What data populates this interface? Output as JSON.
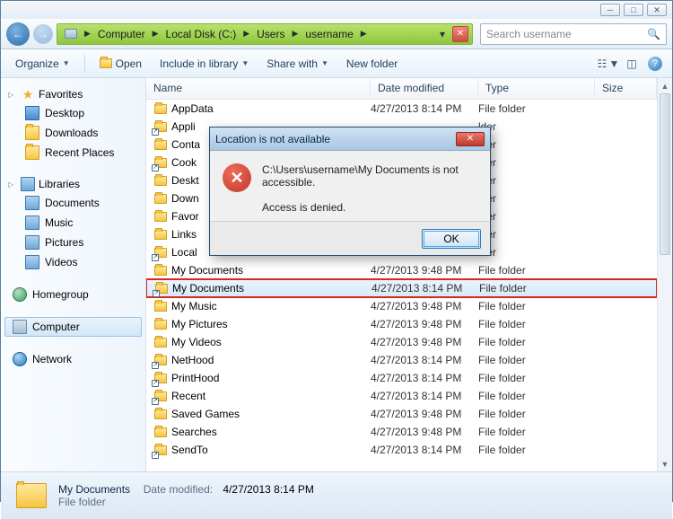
{
  "window": {
    "min": "─",
    "max": "□",
    "close": "✕"
  },
  "nav": {
    "back_icon": "←",
    "fwd_icon": "→"
  },
  "breadcrumb": [
    {
      "label": "Computer"
    },
    {
      "label": "Local Disk (C:)"
    },
    {
      "label": "Users"
    },
    {
      "label": "username"
    }
  ],
  "search": {
    "placeholder": "Search username",
    "icon": "🔍"
  },
  "toolbar": {
    "organize": "Organize",
    "open": "Open",
    "include": "Include in library",
    "share": "Share with",
    "newfolder": "New folder"
  },
  "sidebar": {
    "favorites": {
      "label": "Favorites",
      "items": [
        "Desktop",
        "Downloads",
        "Recent Places"
      ]
    },
    "libraries": {
      "label": "Libraries",
      "items": [
        "Documents",
        "Music",
        "Pictures",
        "Videos"
      ]
    },
    "homegroup": "Homegroup",
    "computer": "Computer",
    "network": "Network"
  },
  "columns": {
    "name": "Name",
    "date": "Date modified",
    "type": "Type",
    "size": "Size"
  },
  "rows": [
    {
      "name": "AppData",
      "date": "4/27/2013 8:14 PM",
      "type": "File folder",
      "shortcut": false
    },
    {
      "name": "Appli",
      "date": "",
      "type": "",
      "shortcut": true
    },
    {
      "name": "Conta",
      "date": "",
      "type": "",
      "shortcut": false
    },
    {
      "name": "Cook",
      "date": "",
      "type": "",
      "shortcut": true
    },
    {
      "name": "Deskt",
      "date": "",
      "type": "",
      "shortcut": false
    },
    {
      "name": "Down",
      "date": "",
      "type": "",
      "shortcut": false
    },
    {
      "name": "Favor",
      "date": "",
      "type": "",
      "shortcut": false
    },
    {
      "name": "Links",
      "date": "",
      "type": "",
      "shortcut": false
    },
    {
      "name": "Local",
      "date": "",
      "type": "",
      "shortcut": true
    },
    {
      "name": "My Documents",
      "date": "4/27/2013 9:48 PM",
      "type": "File folder",
      "shortcut": false
    },
    {
      "name": "My Documents",
      "date": "4/27/2013 8:14 PM",
      "type": "File folder",
      "shortcut": true,
      "selected": true,
      "highlight": true
    },
    {
      "name": "My Music",
      "date": "4/27/2013 9:48 PM",
      "type": "File folder",
      "shortcut": false
    },
    {
      "name": "My Pictures",
      "date": "4/27/2013 9:48 PM",
      "type": "File folder",
      "shortcut": false
    },
    {
      "name": "My Videos",
      "date": "4/27/2013 9:48 PM",
      "type": "File folder",
      "shortcut": false
    },
    {
      "name": "NetHood",
      "date": "4/27/2013 8:14 PM",
      "type": "File folder",
      "shortcut": true
    },
    {
      "name": "PrintHood",
      "date": "4/27/2013 8:14 PM",
      "type": "File folder",
      "shortcut": true
    },
    {
      "name": "Recent",
      "date": "4/27/2013 8:14 PM",
      "type": "File folder",
      "shortcut": true
    },
    {
      "name": "Saved Games",
      "date": "4/27/2013 9:48 PM",
      "type": "File folder",
      "shortcut": false
    },
    {
      "name": "Searches",
      "date": "4/27/2013 9:48 PM",
      "type": "File folder",
      "shortcut": false
    },
    {
      "name": "SendTo",
      "date": "4/27/2013 8:14 PM",
      "type": "File folder",
      "shortcut": true
    }
  ],
  "obscured_type": "lder",
  "details": {
    "name": "My Documents",
    "datelabel": "Date modified:",
    "date": "4/27/2013 8:14 PM",
    "type": "File folder"
  },
  "dialog": {
    "title": "Location is not available",
    "line1": "C:\\Users\\username\\My Documents is not accessible.",
    "line2": "Access is denied.",
    "ok": "OK"
  }
}
